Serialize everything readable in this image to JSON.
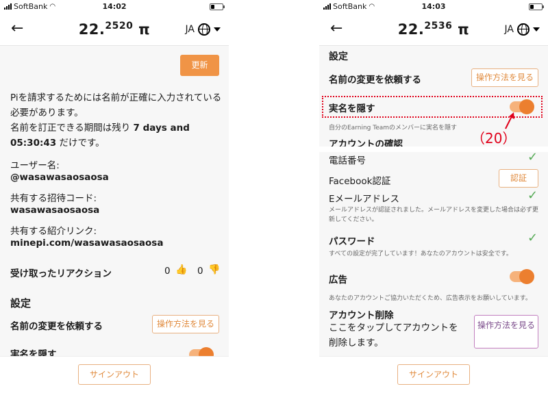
{
  "left_screen": {
    "status": {
      "carrier": "SoftBank",
      "time": "14:02"
    },
    "header": {
      "balance_int": "22.",
      "balance_dec": "2520",
      "pi": "π",
      "language": "JA"
    },
    "refresh_button": "更新",
    "notice_line1": "Piを請求するためには名前が正確に入力されている必要があります。",
    "notice_line2a": "名前を訂正できる期間は残り ",
    "notice_line2b": "7 days and 05:30:43",
    "notice_line2c": " だけです。",
    "username_label": "ユーザー名:",
    "username_value": "@wasawasaosaosa",
    "invite_label": "共有する招待コード:",
    "invite_value": "wasawasaosaosa",
    "referral_label": "共有する紹介リンク:",
    "referral_value": "minepi.com/wasawasaosaosa",
    "reactions_label": "受け取ったリアクション",
    "likes": "0",
    "dislikes": "0",
    "settings_heading": "設定",
    "rename_label": "名前の変更を依頼する",
    "rename_button": "操作方法を見る",
    "hide_name_label": "実名を隠す",
    "signout": "サインアウト"
  },
  "right_screen": {
    "status": {
      "carrier": "SoftBank",
      "time": "14:03"
    },
    "header": {
      "balance_int": "22.",
      "balance_dec": "2536",
      "pi": "π",
      "language": "JA"
    },
    "settings_heading": "設定",
    "rename_label": "名前の変更を依頼する",
    "rename_button": "操作方法を見る",
    "hide_name_label": "実名を隠す",
    "hide_name_toggle_on": true,
    "hide_name_desc": "自分のEarning Teamのメンバーに実名を隠す",
    "verification_heading": "アカウントの確認",
    "phone_label": "電話番号",
    "facebook_label": "Facebook認証",
    "facebook_button": "認証",
    "email_label": "Eメールアドレス",
    "email_desc": "メールアドレスが認証されました。メールアドレスを変更した場合は必ず更新してください。",
    "password_label": "パスワード",
    "password_desc": "すべての設定が完了しています！あなたのアカウントは安全です。",
    "ads_label": "広告",
    "ads_toggle_on": true,
    "ads_desc": "あなたのアカウントご協力いただくため、広告表示をお願いしています。",
    "delete_heading": "アカウント削除",
    "delete_desc": "ここをタップしてアカウントを削除します。",
    "delete_button": "操作方法を見る",
    "signout": "サインアウト"
  },
  "annotation": "（20）",
  "colors": {
    "accent": "#f09446",
    "toggle": "#ec7f2f",
    "check": "#55aa55",
    "highlight": "#e0001a"
  },
  "icons": [
    "back-arrow-icon",
    "globe-icon",
    "chevron-down-icon",
    "thumbs-up-icon",
    "thumbs-down-icon",
    "check-icon",
    "wifi-icon",
    "battery-icon"
  ]
}
